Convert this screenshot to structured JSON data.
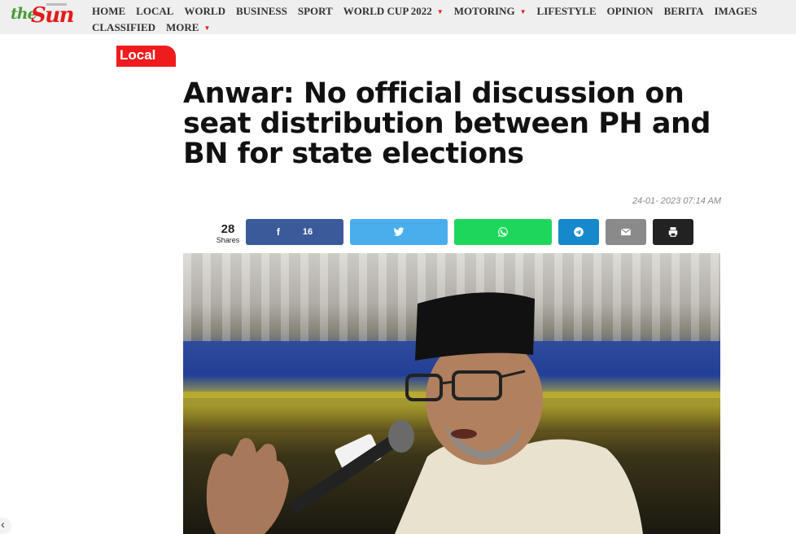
{
  "brand": {
    "the": "the",
    "sun": "Sun"
  },
  "nav": {
    "row1": [
      {
        "label": "HOME",
        "dropdown": false
      },
      {
        "label": "LOCAL",
        "dropdown": false
      },
      {
        "label": "WORLD",
        "dropdown": false
      },
      {
        "label": "BUSINESS",
        "dropdown": false
      },
      {
        "label": "SPORT",
        "dropdown": false
      },
      {
        "label": "WORLD CUP 2022",
        "dropdown": true
      },
      {
        "label": "MOTORING",
        "dropdown": true
      },
      {
        "label": "LIFESTYLE",
        "dropdown": false
      },
      {
        "label": "OPINION",
        "dropdown": false
      },
      {
        "label": "BERITA",
        "dropdown": false
      },
      {
        "label": "IMAGES",
        "dropdown": false
      }
    ],
    "row2": [
      {
        "label": "CLASSIFIED",
        "dropdown": false
      },
      {
        "label": "MORE",
        "dropdown": true
      }
    ],
    "caret": "▼"
  },
  "article": {
    "category": "Local",
    "headline": "Anwar: No official discussion on seat distribution between PH and BN for state elections",
    "date": "24-01- 2023 07:14 AM"
  },
  "share": {
    "count": "28",
    "count_label": "Shares",
    "facebook": {
      "icon": "f",
      "count": "16"
    },
    "icons": [
      "facebook-icon",
      "twitter-icon",
      "whatsapp-icon",
      "telegram-icon",
      "email-icon",
      "print-icon"
    ]
  },
  "pager": {
    "prev": "‹"
  },
  "colors": {
    "brand_red": "#e31b1b",
    "brand_green": "#4a9b3a",
    "category_red": "#ee1c1c",
    "facebook": "#3b5a9a",
    "twitter": "#4aaeec",
    "whatsapp": "#1fd65d",
    "telegram": "#1688cc",
    "email": "#8a8a8a",
    "print": "#222222"
  }
}
